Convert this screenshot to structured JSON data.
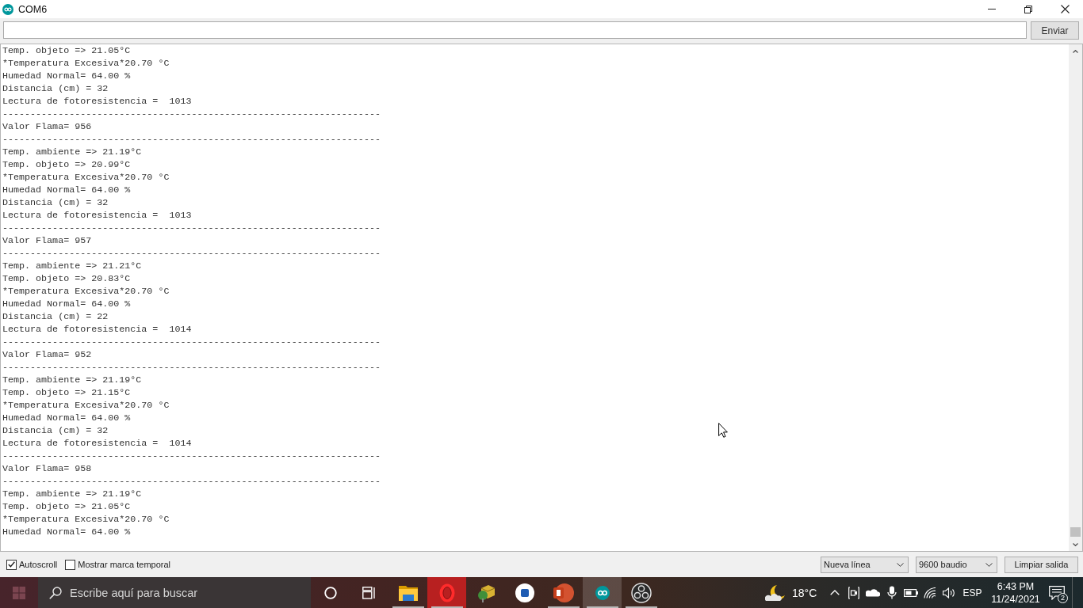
{
  "window": {
    "title": "COM6"
  },
  "send_bar": {
    "button": "Enviar"
  },
  "output": {
    "lines": [
      "Temp. objeto => 21.05°C",
      "*Temperatura Excesiva*20.70 °C",
      "Humedad Normal= 64.00 %",
      "Distancia (cm) = 32",
      "Lectura de fotoresistencia =  1013",
      "--------------------------------------------------------------------",
      "Valor Flama= 956",
      "--------------------------------------------------------------------",
      "Temp. ambiente => 21.19°C",
      "Temp. objeto => 20.99°C",
      "*Temperatura Excesiva*20.70 °C",
      "Humedad Normal= 64.00 %",
      "Distancia (cm) = 32",
      "Lectura de fotoresistencia =  1013",
      "--------------------------------------------------------------------",
      "Valor Flama= 957",
      "--------------------------------------------------------------------",
      "Temp. ambiente => 21.21°C",
      "Temp. objeto => 20.83°C",
      "*Temperatura Excesiva*20.70 °C",
      "Humedad Normal= 64.00 %",
      "Distancia (cm) = 22",
      "Lectura de fotoresistencia =  1014",
      "--------------------------------------------------------------------",
      "Valor Flama= 952",
      "--------------------------------------------------------------------",
      "Temp. ambiente => 21.19°C",
      "Temp. objeto => 21.15°C",
      "*Temperatura Excesiva*20.70 °C",
      "Humedad Normal= 64.00 %",
      "Distancia (cm) = 32",
      "Lectura de fotoresistencia =  1014",
      "--------------------------------------------------------------------",
      "Valor Flama= 958",
      "--------------------------------------------------------------------",
      "Temp. ambiente => 21.19°C",
      "Temp. objeto => 21.05°C",
      "*Temperatura Excesiva*20.70 °C",
      "Humedad Normal= 64.00 %"
    ]
  },
  "footer": {
    "checkboxes": [
      {
        "label": "Autoscroll",
        "checked": true
      },
      {
        "label": "Mostrar marca temporal",
        "checked": false
      }
    ],
    "line_ending": "Nueva línea",
    "baud_rate": "9600 baudio",
    "clear_button": "Limpiar salida"
  },
  "taskbar": {
    "search": {
      "placeholder": "Escribe aquí para buscar"
    },
    "apps": [
      {
        "kind": "folder",
        "running": true,
        "selected": false,
        "highlighted": false
      },
      {
        "kind": "opera",
        "running": true,
        "selected": false,
        "highlighted": true
      },
      {
        "kind": "cube",
        "running": false,
        "selected": false,
        "highlighted": false
      },
      {
        "kind": "disc",
        "running": false,
        "selected": false,
        "highlighted": false
      },
      {
        "kind": "presentation",
        "running": true,
        "selected": false,
        "highlighted": false
      },
      {
        "kind": "arduino",
        "running": true,
        "selected": true,
        "highlighted": false
      },
      {
        "kind": "obs",
        "running": true,
        "selected": false,
        "highlighted": false
      }
    ],
    "weather": {
      "temperature": "18°C"
    },
    "language": "ESP",
    "time": "6:43 PM",
    "date": "11/24/2021",
    "notification_count": "2"
  }
}
